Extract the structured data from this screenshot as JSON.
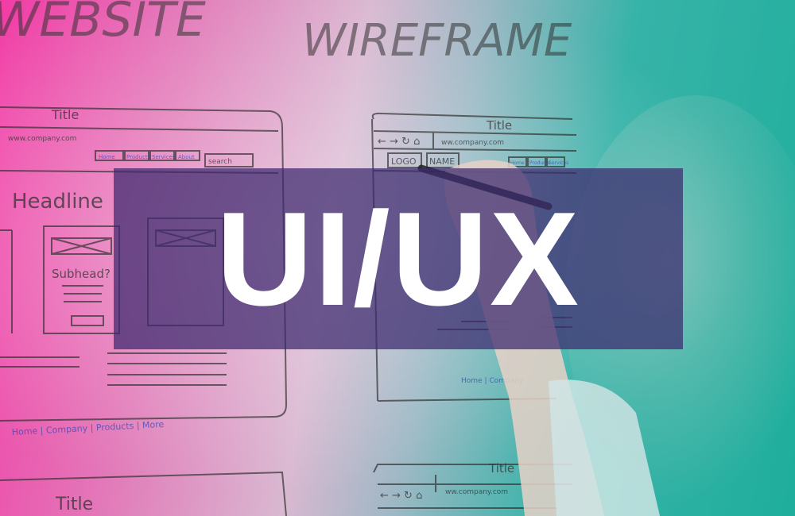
{
  "banner": {
    "title": "UI/UX"
  },
  "sketch": {
    "heading_left": "WEBSITE",
    "heading_right": "WIREFRAME",
    "wireframe_1": {
      "title": "Title",
      "url": "www.company.com",
      "nav": [
        "Home",
        "Products",
        "Services",
        "About"
      ],
      "search": "search",
      "headline": "Headline",
      "subhead": "Subhead?",
      "footer": "Home | Company | Products | More"
    },
    "wireframe_2": {
      "title": "Title",
      "url": "ww.company.com",
      "logo": "LOGO",
      "name": "NAME",
      "nav": [
        "Home",
        "Products",
        "Services"
      ],
      "footer": "Home | Company"
    },
    "wireframe_3": {
      "title": "Title"
    },
    "wireframe_4": {
      "title": "Title",
      "url": "ww.company.com"
    }
  }
}
